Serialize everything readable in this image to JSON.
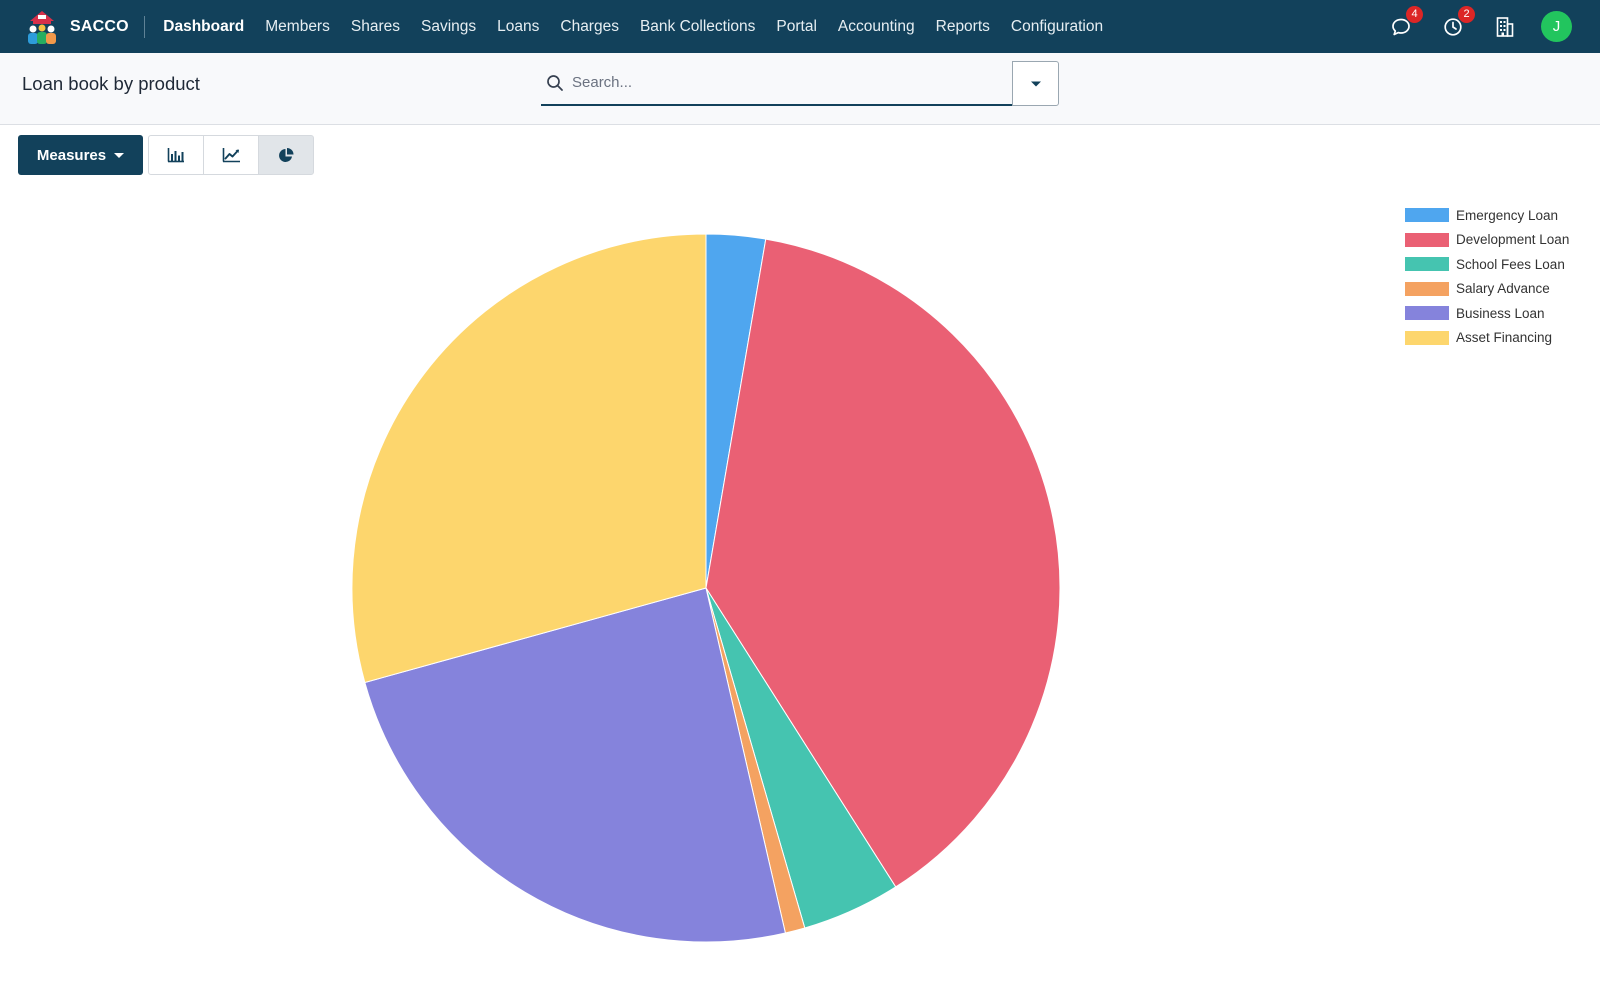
{
  "brand": {
    "name": "SACCO"
  },
  "nav": {
    "items": [
      {
        "label": "Dashboard",
        "active": true
      },
      {
        "label": "Members"
      },
      {
        "label": "Shares"
      },
      {
        "label": "Savings"
      },
      {
        "label": "Loans"
      },
      {
        "label": "Charges"
      },
      {
        "label": "Bank Collections"
      },
      {
        "label": "Portal"
      },
      {
        "label": "Accounting"
      },
      {
        "label": "Reports"
      },
      {
        "label": "Configuration"
      }
    ],
    "messages_count": "4",
    "activities_count": "2",
    "user_initial": "J"
  },
  "page": {
    "title": "Loan book by product"
  },
  "search": {
    "placeholder": "Search..."
  },
  "toolbar": {
    "measures_label": "Measures",
    "views": [
      {
        "icon": "bar-chart-icon",
        "active": false
      },
      {
        "icon": "line-chart-icon",
        "active": false
      },
      {
        "icon": "pie-chart-icon",
        "active": true
      }
    ]
  },
  "colors": {
    "navbar": "#12415b",
    "accent": "#12415b",
    "badge": "#dc2626",
    "avatar": "#22c55e"
  },
  "chart_data": {
    "type": "pie",
    "categories": [
      "Emergency Loan",
      "Development Loan",
      "School Fees Loan",
      "Salary Advance",
      "Business Loan",
      "Asset Financing"
    ],
    "values": [
      2.7,
      38.3,
      4.5,
      0.9,
      24.3,
      29.3
    ],
    "colors": [
      "#4fa6ef",
      "#ea6074",
      "#45c4b0",
      "#f4a261",
      "#8583dc",
      "#fdd66d"
    ],
    "legend_position": "top-right"
  }
}
